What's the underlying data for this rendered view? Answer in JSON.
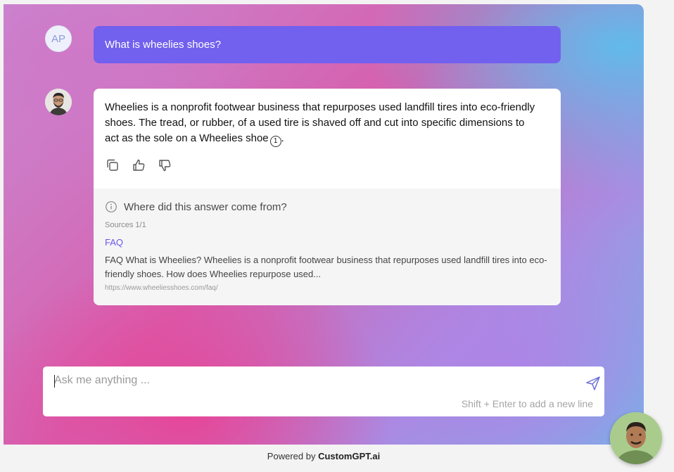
{
  "conversation": {
    "user": {
      "avatar_initials": "AP",
      "message": "What is wheelies shoes?"
    },
    "bot": {
      "answer": "Wheelies is a nonprofit footwear business that repurposes used landfill tires into eco-friendly shoes. The tread, or rubber, of a used tire is shaved off and cut into specific dimensions to act as the sole on a Wheelies shoe",
      "citation_marker": "1",
      "answer_end": ".",
      "actions": [
        {
          "name": "copy-icon"
        },
        {
          "name": "thumbs-up-icon"
        },
        {
          "name": "thumbs-down-icon"
        }
      ],
      "sources": {
        "heading": "Where did this answer come from?",
        "count": "Sources 1/1",
        "items": [
          {
            "title": "FAQ",
            "snippet": "FAQ What is Wheelies? Wheelies is a nonprofit footwear business that repurposes used landfill tires into eco-friendly shoes. How does Wheelies repurpose used...",
            "url": "https://www.wheeliesshoes.com/faq/"
          }
        ]
      }
    }
  },
  "composer": {
    "placeholder": "Ask me anything ...",
    "value": "",
    "hint": "Shift + Enter to add a new line"
  },
  "footer": {
    "prefix": "Powered by",
    "brand": "CustomGPT.ai"
  },
  "colors": {
    "user_bubble": "#7260ee",
    "link": "#6a57e8"
  }
}
